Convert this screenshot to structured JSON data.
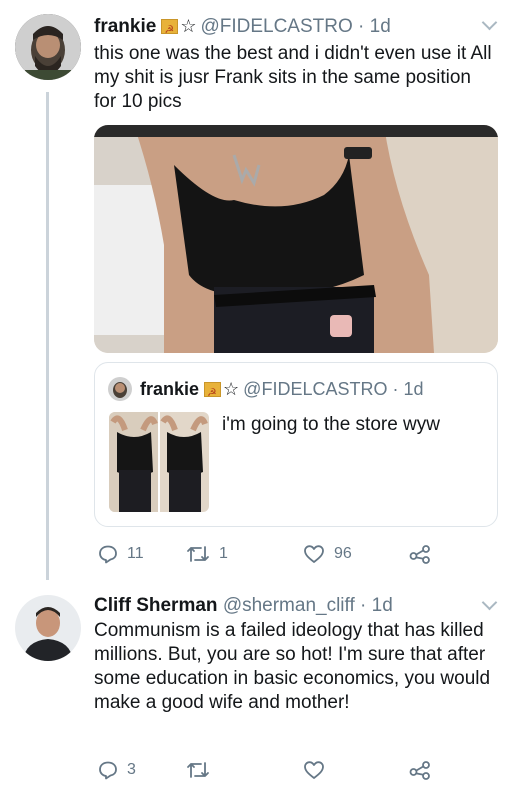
{
  "tweet1": {
    "name": "frankie",
    "handle": "@FIDELCASTRO",
    "time": "1d",
    "text": "this one was the best and i didn't even use it All my shit is jusr Frank sits in the same position for 10 pics",
    "quote": {
      "name": "frankie",
      "handle": "@FIDELCASTRO",
      "time": "1d",
      "text": "i'm going to the store wyw"
    },
    "actions": {
      "replies": "11",
      "retweets": "1",
      "likes": "96"
    }
  },
  "tweet2": {
    "name": "Cliff Sherman",
    "handle": "@sherman_cliff",
    "time": "1d",
    "text": "Communism is a failed ideology that has killed millions. But, you are so hot! I'm sure that after some education in basic economics, you would make a good wife and mother!",
    "actions": {
      "replies": "3",
      "retweets": "",
      "likes": ""
    }
  },
  "icons": [
    "reply-icon",
    "retweet-icon",
    "like-icon",
    "share-icon",
    "chevron-down-icon",
    "star-icon",
    "flag-icon"
  ],
  "colors": {
    "muted": "#657786",
    "divider": "#cbd3da",
    "text": "#14171a"
  }
}
